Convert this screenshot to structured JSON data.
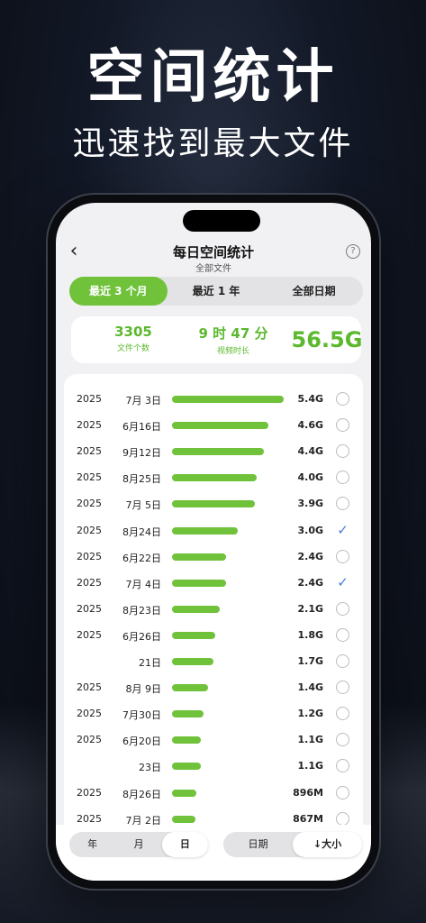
{
  "promo": {
    "title": "空间统计",
    "subtitle": "迅速找到最大文件"
  },
  "nav": {
    "back_icon": "‹",
    "title": "每日空间统计",
    "subtitle": "全部文件",
    "help_icon": "?"
  },
  "range_tabs": [
    {
      "label": "最近 3 个月",
      "active": true
    },
    {
      "label": "最近 1 年",
      "active": false
    },
    {
      "label": "全部日期",
      "active": false
    }
  ],
  "stats": {
    "file_count": "3305",
    "file_count_label": "文件个数",
    "duration": "9 时 47 分",
    "duration_label": "视频时长",
    "total_size": "56.5G"
  },
  "rows": [
    {
      "year": "2025",
      "date": "7月 3日",
      "size": "5.4G",
      "fraction": 1.0,
      "checked": false
    },
    {
      "year": "2025",
      "date": "6月16日",
      "size": "4.6G",
      "fraction": 0.86,
      "checked": false
    },
    {
      "year": "2025",
      "date": "9月12日",
      "size": "4.4G",
      "fraction": 0.82,
      "checked": false
    },
    {
      "year": "2025",
      "date": "8月25日",
      "size": "4.0G",
      "fraction": 0.76,
      "checked": false
    },
    {
      "year": "2025",
      "date": "7月 5日",
      "size": "3.9G",
      "fraction": 0.74,
      "checked": false
    },
    {
      "year": "2025",
      "date": "8月24日",
      "size": "3.0G",
      "fraction": 0.59,
      "checked": true
    },
    {
      "year": "2025",
      "date": "6月22日",
      "size": "2.4G",
      "fraction": 0.48,
      "checked": false
    },
    {
      "year": "2025",
      "date": "7月 4日",
      "size": "2.4G",
      "fraction": 0.48,
      "checked": true
    },
    {
      "year": "2025",
      "date": "8月23日",
      "size": "2.1G",
      "fraction": 0.43,
      "checked": false
    },
    {
      "year": "2025",
      "date": "6月26日",
      "size": "1.8G",
      "fraction": 0.39,
      "checked": false
    },
    {
      "year": "",
      "date": "21日",
      "size": "1.7G",
      "fraction": 0.37,
      "checked": false
    },
    {
      "year": "2025",
      "date": "8月 9日",
      "size": "1.4G",
      "fraction": 0.32,
      "checked": false
    },
    {
      "year": "2025",
      "date": "7月30日",
      "size": "1.2G",
      "fraction": 0.28,
      "checked": false
    },
    {
      "year": "2025",
      "date": "6月20日",
      "size": "1.1G",
      "fraction": 0.26,
      "checked": false
    },
    {
      "year": "",
      "date": "23日",
      "size": "1.1G",
      "fraction": 0.26,
      "checked": false
    },
    {
      "year": "2025",
      "date": "8月26日",
      "size": "896M",
      "fraction": 0.22,
      "checked": false
    },
    {
      "year": "2025",
      "date": "7月 2日",
      "size": "867M",
      "fraction": 0.21,
      "checked": false
    }
  ],
  "check_icon": "✓",
  "period_tabs": [
    {
      "label": "年",
      "active": false
    },
    {
      "label": "月",
      "active": false
    },
    {
      "label": "日",
      "active": true
    }
  ],
  "sort_tabs": [
    {
      "label": "日期",
      "active": false
    },
    {
      "label": "↓大小",
      "active": true
    }
  ],
  "colors": {
    "accent": "#6fc23a",
    "stat_text": "#5cb82e",
    "check": "#4a7bdc"
  }
}
